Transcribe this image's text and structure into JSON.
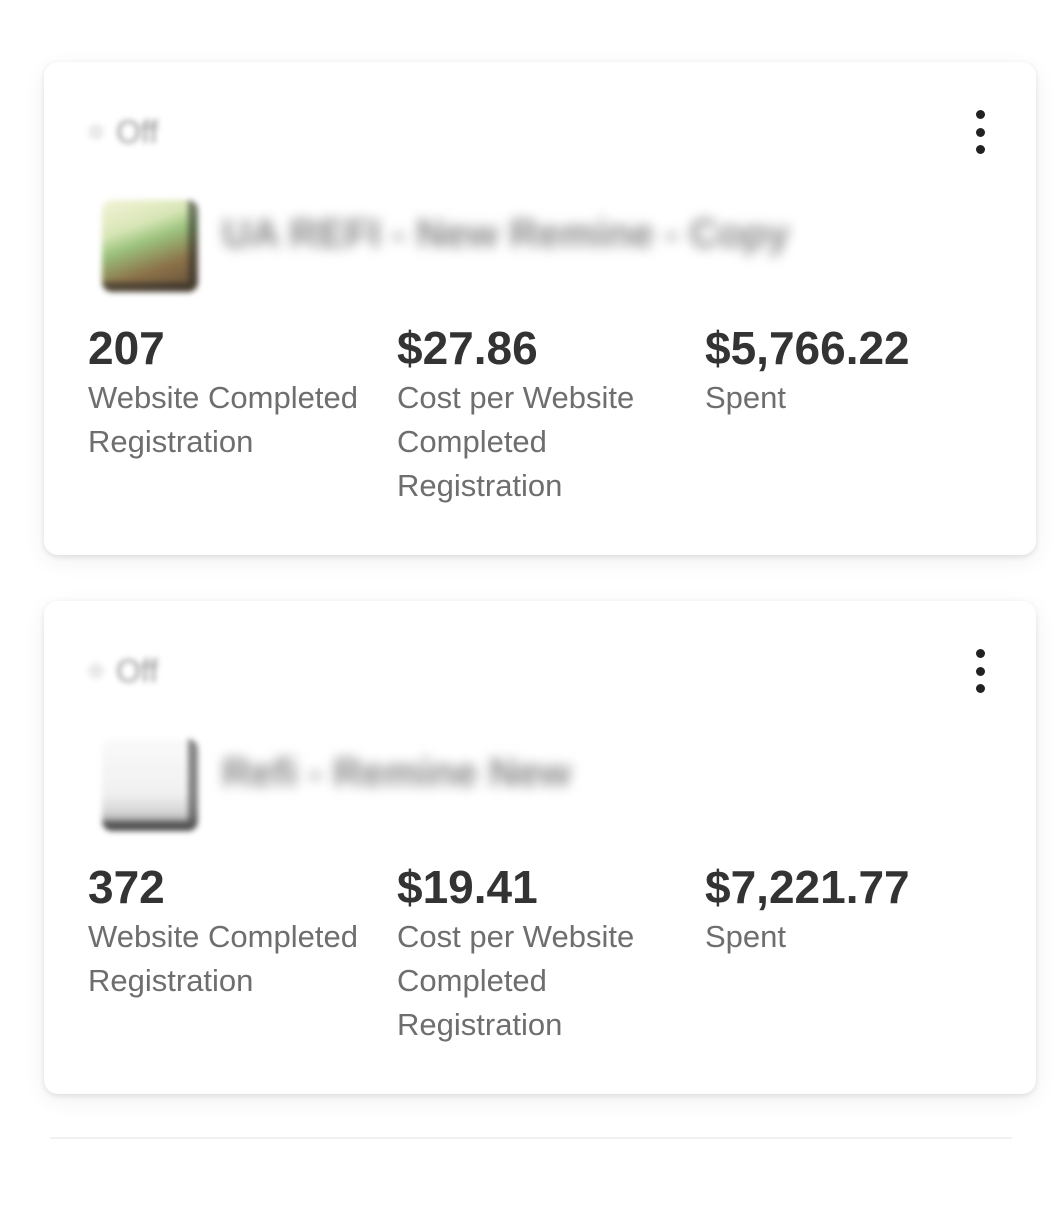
{
  "cards": [
    {
      "status": "Off",
      "ad_name": "UA REFI - New Remine - Copy",
      "metrics": [
        {
          "value": "207",
          "label": "Website Completed Registration"
        },
        {
          "value": "$27.86",
          "label": "Cost per Website Completed Registration"
        },
        {
          "value": "$5,766.22",
          "label": "Spent"
        }
      ]
    },
    {
      "status": "Off",
      "ad_name": "Refi - Remine New",
      "metrics": [
        {
          "value": "372",
          "label": "Website Completed Registration"
        },
        {
          "value": "$19.41",
          "label": "Cost per Website Completed Registration"
        },
        {
          "value": "$7,221.77",
          "label": "Spent"
        }
      ]
    }
  ],
  "icons": {
    "more": "more-vertical-icon",
    "status": "status-dot-icon"
  },
  "colors": {
    "value_text": "#333333",
    "label_text": "#6e6e6e",
    "card_background": "#ffffff"
  }
}
